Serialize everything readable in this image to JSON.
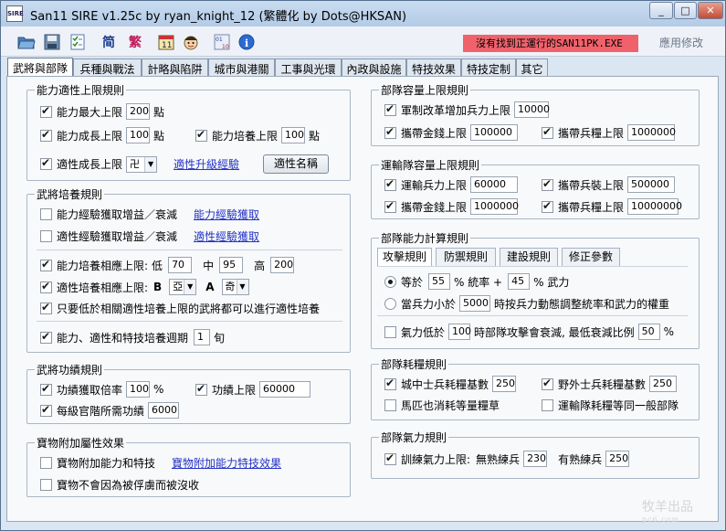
{
  "window": {
    "title": "San11 SIRE v1.25c by ryan_knight_12 (繁體化 by Dots@HKSAN)",
    "app_icon_text": "SIRE",
    "controls": {
      "minimize": "▭",
      "maximize": "▭",
      "close": "✕"
    }
  },
  "toolbar": {
    "icons": [
      "open-folder-icon",
      "save-icon",
      "checklist-icon",
      "simplified-icon",
      "traditional-icon",
      "calendar-icon",
      "face-icon",
      "numbers-icon",
      "info-icon"
    ],
    "simplified_label": "简",
    "traditional_label": "繁",
    "status_text": "沒有找到正運行的SAN11PK.EXE",
    "apply_label": "應用修改",
    "colors": {
      "status_bg": "#f0626b"
    }
  },
  "tabs": [
    "武將與部隊",
    "兵種與戰法",
    "計略與陷阱",
    "城市與港關",
    "工事與光環",
    "內政與設施",
    "特技效果",
    "特技定制",
    "其它"
  ],
  "ability": {
    "title": "能力適性上限規則",
    "max_label": "能力最大上限",
    "max_value": "200",
    "max_unit": "點",
    "growth_label": "能力成長上限",
    "growth_value": "100",
    "growth_unit": "點",
    "train_label": "能力培養上限",
    "train_value": "100",
    "train_unit": "點",
    "apt_label": "適性成長上限",
    "apt_value": "卍",
    "apt_link": "適性升級經驗",
    "apt_name_button": "適性名稱"
  },
  "training": {
    "title": "武將培養規則",
    "ability_exp_label": "能力經驗獲取增益／衰減",
    "ability_exp_link": "能力經驗獲取",
    "apt_exp_label": "適性經驗獲取增益／衰減",
    "apt_exp_link": "適性經驗獲取",
    "relation_label": "能力培養相應上限:",
    "low_label": "低",
    "low_value": "70",
    "mid_label": "中",
    "mid_value": "95",
    "high_label": "高",
    "high_value": "200",
    "apt_relation_label": "適性培養相應上限:",
    "b_label": "B",
    "b_value": "亞",
    "a_label": "A",
    "a_value": "奇",
    "only_below_label": "只要低於相關適性培養上限的武將都可以進行適性培養",
    "cycle_label": "能力、適性和特技培養週期",
    "cycle_value": "1",
    "cycle_unit": "旬"
  },
  "merit": {
    "title": "武將功績規則",
    "rate_label": "功績獲取倍率",
    "rate_value": "100",
    "rate_unit": "%",
    "limit_label": "功績上限",
    "limit_value": "60000",
    "rank_label": "每級官階所需功績",
    "rank_value": "6000"
  },
  "treasure": {
    "title": "寶物附加屬性效果",
    "add_label": "寶物附加能力和特技",
    "add_link": "寶物附加能力特技效果",
    "nolose_label": "寶物不會因為被俘虜而被沒收"
  },
  "capacity": {
    "title": "部隊容量上限規則",
    "reform_label": "軍制改革增加兵力上限",
    "reform_value": "10000",
    "gold_label": "攜帶金錢上限",
    "gold_value": "100000",
    "food_label": "攜帶兵糧上限",
    "food_value": "1000000"
  },
  "transport": {
    "title": "運輸隊容量上限規則",
    "troops_label": "運輸兵力上限",
    "troops_value": "60000",
    "weapons_label": "攜帶兵裝上限",
    "weapons_value": "500000",
    "gold_label": "攜帶金錢上限",
    "gold_value": "1000000",
    "food_label": "攜帶兵糧上限",
    "food_value": "10000000"
  },
  "calc": {
    "title": "部隊能力計算規則",
    "subtabs": [
      "攻擊規則",
      "防禦規則",
      "建設規則",
      "修正參數"
    ],
    "equal_label": "等於",
    "lead_value": "55",
    "lead_label": "% 統率 +",
    "force_value": "45",
    "force_label": "% 武力",
    "dynamic_pre": "當兵力小於",
    "dynamic_value": "5000",
    "dynamic_post": "時按兵力動態調整統率和武力的權重",
    "morale_pre": "氣力低於",
    "morale_value": "100",
    "morale_mid": "時部隊攻擊會衰減,  最低衰減比例",
    "morale_ratio": "50",
    "morale_unit": "%"
  },
  "consume": {
    "title": "部隊耗糧規則",
    "city_label": "城中士兵耗糧基數",
    "city_value": "250",
    "field_label": "野外士兵耗糧基數",
    "field_value": "250",
    "horse_label": "馬匹也消耗等量糧草",
    "transport_label": "運輸隊耗糧等同一般部隊"
  },
  "morale": {
    "title": "部隊氣力規則",
    "train_label": "訓練氣力上限:",
    "untrained_label": "無熟練兵",
    "untrained_value": "230",
    "trained_label": "有熟練兵",
    "trained_value": "250"
  },
  "watermark": {
    "main": "牧羊出品",
    "sub": "pc6.com"
  }
}
